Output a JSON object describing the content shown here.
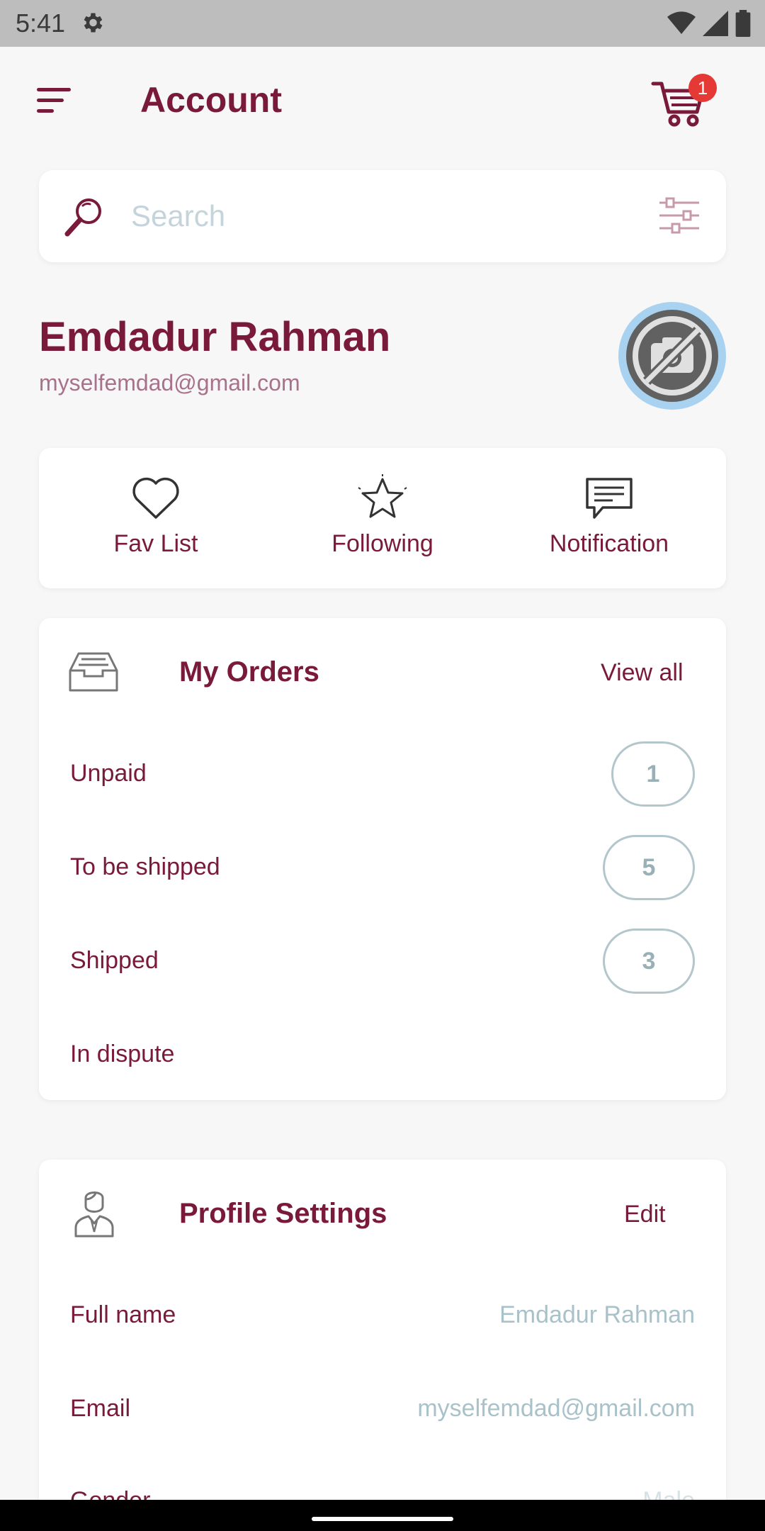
{
  "status_bar": {
    "time": "5:41"
  },
  "app_bar": {
    "title": "Account",
    "cart_count": "1"
  },
  "search": {
    "placeholder": "Search"
  },
  "profile": {
    "name": "Emdadur Rahman",
    "email": "myselfemdad@gmail.com"
  },
  "quick_actions": [
    {
      "label": "Fav List",
      "icon": "heart-icon"
    },
    {
      "label": "Following",
      "icon": "star-icon"
    },
    {
      "label": "Notification",
      "icon": "chat-icon"
    }
  ],
  "orders": {
    "title": "My Orders",
    "view_all": "View all",
    "rows": [
      {
        "label": "Unpaid",
        "count": "1"
      },
      {
        "label": "To be shipped",
        "count": "5"
      },
      {
        "label": "Shipped",
        "count": "3"
      },
      {
        "label": "In dispute",
        "count": ""
      }
    ]
  },
  "profile_settings": {
    "title": "Profile Settings",
    "edit": "Edit",
    "rows": [
      {
        "label": "Full name",
        "value": "Emdadur Rahman"
      },
      {
        "label": "Email",
        "value": "myselfemdad@gmail.com"
      },
      {
        "label": "Gender",
        "value": "Male"
      }
    ]
  },
  "colors": {
    "primary": "#7a1a3a",
    "badge": "#e53935",
    "muted": "#a9c2c9",
    "background": "#f8f7f8"
  }
}
